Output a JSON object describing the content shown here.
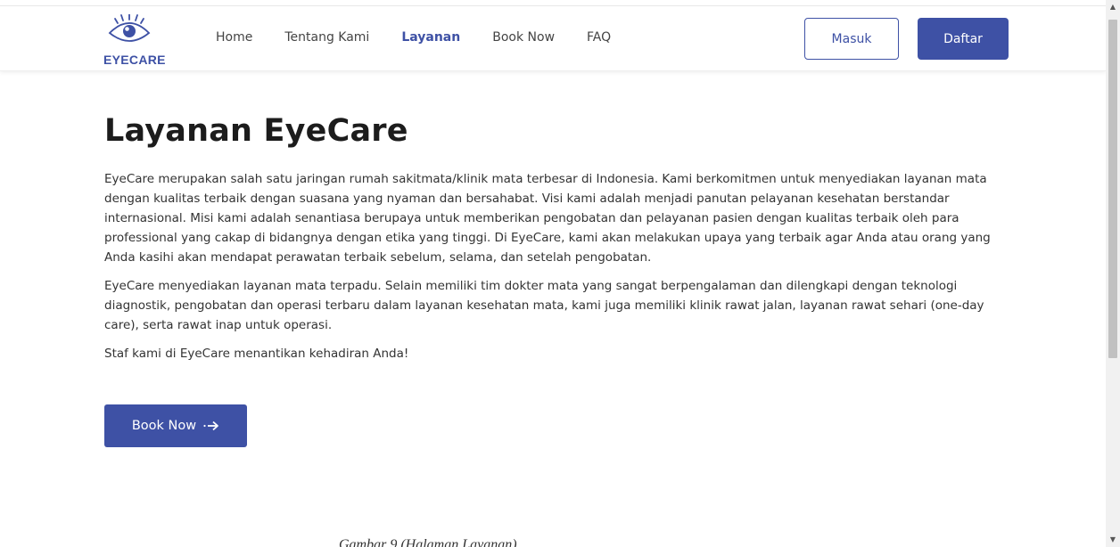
{
  "brand": {
    "name": "EYECARE",
    "color": "#3e51a5",
    "logo_icon": "eye-icon"
  },
  "nav": {
    "links": [
      {
        "label": "Home",
        "active": false
      },
      {
        "label": "Tentang Kami",
        "active": false
      },
      {
        "label": "Layanan",
        "active": true
      },
      {
        "label": "Book Now",
        "active": false
      },
      {
        "label": "FAQ",
        "active": false
      }
    ],
    "login_label": "Masuk",
    "register_label": "Daftar"
  },
  "main": {
    "title": "Layanan EyeCare",
    "paragraphs": [
      "EyeCare merupakan salah satu jaringan rumah sakitmata/klinik mata terbesar di Indonesia. Kami berkomitmen untuk menyediakan layanan mata dengan kualitas terbaik dengan suasana yang nyaman dan bersahabat. Visi kami adalah menjadi panutan pelayanan kesehatan berstandar internasional. Misi kami adalah senantiasa berupaya untuk memberikan pengobatan dan pelayanan pasien dengan kualitas terbaik oleh para professional yang cakap di bidangnya dengan etika yang tinggi. Di EyeCare, kami akan melakukan upaya yang terbaik agar Anda atau orang yang Anda kasihi akan mendapat perawatan terbaik sebelum, selama, dan setelah pengobatan.",
      "EyeCare menyediakan layanan mata terpadu. Selain memiliki tim dokter mata yang sangat berpengalaman dan dilengkapi dengan teknologi diagnostik, pengobatan dan operasi terbaru dalam layanan kesehatan mata, kami juga memiliki klinik rawat jalan, layanan rawat sehari (one-day care), serta rawat inap untuk operasi.",
      "Staf kami di EyeCare menantikan kehadiran Anda!"
    ],
    "cta_label": "Book Now",
    "cta_icon": "arrow-right-icon"
  },
  "caption": "Gambar 9 (Halaman Layanan)",
  "scrollbar": {
    "up_glyph": "▲",
    "down_glyph": "▼"
  }
}
